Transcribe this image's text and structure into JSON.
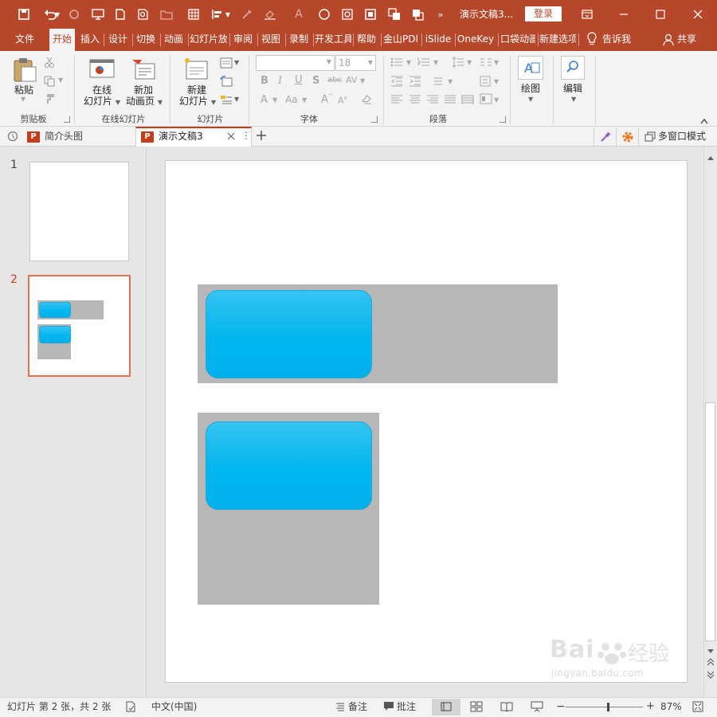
{
  "window": {
    "title": "演示文稿3...",
    "login_label": "登录",
    "accent": "#b7472a"
  },
  "ribbon_tabs": [
    {
      "label": "文件",
      "active": false
    },
    {
      "label": "开始",
      "active": true
    },
    {
      "label": "插入",
      "active": false
    },
    {
      "label": "设计",
      "active": false
    },
    {
      "label": "切换",
      "active": false
    },
    {
      "label": "动画",
      "active": false
    },
    {
      "label": "幻灯片放",
      "active": false
    },
    {
      "label": "审阅",
      "active": false
    },
    {
      "label": "视图",
      "active": false
    },
    {
      "label": "录制",
      "active": false
    },
    {
      "label": "开发工具",
      "active": false
    },
    {
      "label": "帮助",
      "active": false
    },
    {
      "label": "金山PDI",
      "active": false
    },
    {
      "label": "iSlide",
      "active": false
    },
    {
      "label": "OneKey",
      "active": false
    },
    {
      "label": "口袋动画",
      "active": false
    },
    {
      "label": "新建选项",
      "active": false
    }
  ],
  "tell_me": "告诉我",
  "share": "共享",
  "ribbon": {
    "clipboard": {
      "paste": "粘贴",
      "group": "剪贴板"
    },
    "online": {
      "btn1_l1": "在线",
      "btn1_l2": "幻灯片",
      "btn2_l1": "新加",
      "btn2_l2": "动画页",
      "group": "在线幻灯片"
    },
    "slides": {
      "new_l1": "新建",
      "new_l2": "幻灯片",
      "group": "幻灯片"
    },
    "font": {
      "name_value": "",
      "size_value": "18",
      "group": "字体"
    },
    "paragraph": {
      "group": "段落"
    },
    "drawing": {
      "label": "绘图"
    },
    "editing": {
      "label": "编辑"
    }
  },
  "doc_tabs": [
    {
      "label": "简介头图",
      "active": false
    },
    {
      "label": "演示文稿3",
      "active": true
    }
  ],
  "multiwindow": "多窗口模式",
  "slides": [
    {
      "number": "1",
      "selected": false
    },
    {
      "number": "2",
      "selected": true
    }
  ],
  "status": {
    "slide_info": "幻灯片 第 2 张，共 2 张",
    "language": "中文(中国)",
    "notes": "备注",
    "comments": "批注",
    "zoom": "87%",
    "zoom_fraction": 0.55
  },
  "watermark": {
    "brand": "Bai",
    "brand2": "经验",
    "url": "jingyan.baidu.com"
  }
}
